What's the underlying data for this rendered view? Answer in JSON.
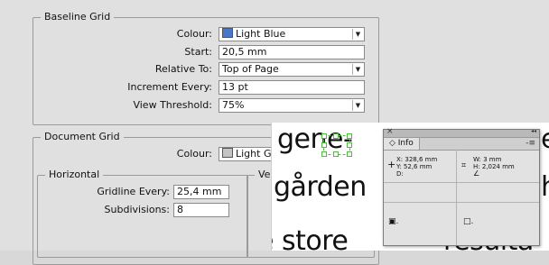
{
  "baseline": {
    "title": "Baseline Grid",
    "colour_label": "Colour:",
    "colour_value": "Light Blue",
    "colour_swatch": "#4a78c8",
    "start_label": "Start:",
    "start_value": "20,5 mm",
    "relative_label": "Relative To:",
    "relative_value": "Top of Page",
    "increment_label": "Increment Every:",
    "increment_value": "13 pt",
    "threshold_label": "View Threshold:",
    "threshold_value": "75%"
  },
  "document": {
    "title": "Document Grid",
    "colour_label": "Colour:",
    "colour_value": "Light Grey",
    "colour_swatch": "#c4c4c4",
    "horizontal_title": "Horizontal",
    "gridline_label": "Gridline Every:",
    "gridline_value": "25,4 mm",
    "subdiv_label": "Subdivisions:",
    "subdiv_value": "8",
    "vertical_title": "Vertica"
  },
  "textframe": {
    "line1": "gene-",
    "line1_tail": "e",
    "line2": "gården",
    "line2_tail": "h",
    "line3": "e store",
    "line3_tail": "resulta"
  },
  "info_panel": {
    "tab_label": "◇ Info",
    "close_glyph": "×",
    "collapse_glyph": "◂◂",
    "menu_glyph": "-≡",
    "x": "X: 328,6 mm",
    "y": "Y: 52,6 mm",
    "d": "D:",
    "w": "W: 3 mm",
    "h": "H: 2,024 mm",
    "crosshair_icon": "+",
    "size_icon": "⌗",
    "angle_icon": "∠",
    "fill_icon": "▣.",
    "stroke_icon": "□."
  }
}
